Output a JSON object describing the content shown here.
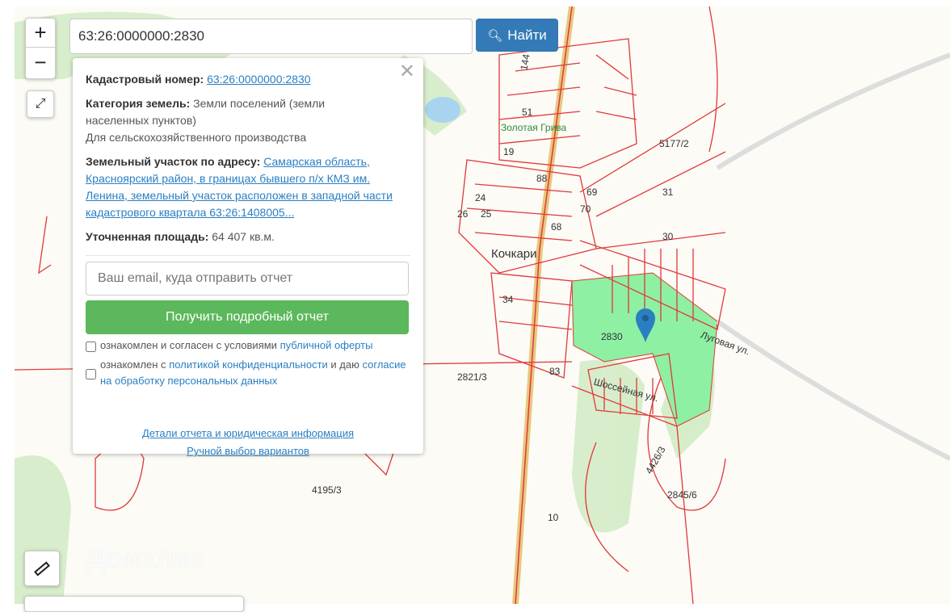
{
  "search": {
    "value": "63:26:0000000:2830",
    "button": "Найти",
    "icon": "search-icon"
  },
  "zoom": {
    "in": "+",
    "out": "−"
  },
  "popup": {
    "cadastral_label": "Кадастровый номер:",
    "cadastral_value": "63:26:0000000:2830",
    "category_label": "Категория земель:",
    "category_value": "Земли поселений (земли населенных пунктов)",
    "usage": "Для сельскохозяйственного производства",
    "address_label": "Земельный участок по адресу:",
    "address_value": "Самарская область, Красноярский район, в границах бывшего п/х КМЗ им. Ленина, земельный участок расположен в западной части кадастрового квартала 63:26:1408005...",
    "area_label": "Уточненная площадь:",
    "area_value": "64 407 кв.м.",
    "email_placeholder": "Ваш email, куда отправить отчет",
    "get_report": "Получить подробный отчет",
    "check1_text": "ознакомлен и согласен с условиями",
    "check1_link": "публичной оферты",
    "check2_text": "ознакомлен с",
    "check2_link": "политикой конфиденциальности",
    "check2_mid": "и даю",
    "check2_link2": "согласие на обработку персональных данных",
    "details_link": "Детали отчета и юридическая информация",
    "manual_link": "Ручной выбор вариантов"
  },
  "map": {
    "watermark": "Домклик",
    "labels": [
      "144",
      "51",
      "Золотая Грива",
      "19",
      "88",
      "69",
      "70",
      "24",
      "26",
      "25",
      "68",
      "5177/2",
      "31",
      "30",
      "Кочкари",
      "34",
      "2830",
      "Луговая ул.",
      "Шоссейная ул.",
      "83",
      "2821/3",
      "4426/3",
      "2845/6",
      "4195/3",
      "10"
    ],
    "colors": {
      "parcel": "#e0393b",
      "selected": "#8ef0a2",
      "green": "#cdeac0",
      "road": "#e8c77e",
      "pin": "#2a7fc2"
    }
  }
}
